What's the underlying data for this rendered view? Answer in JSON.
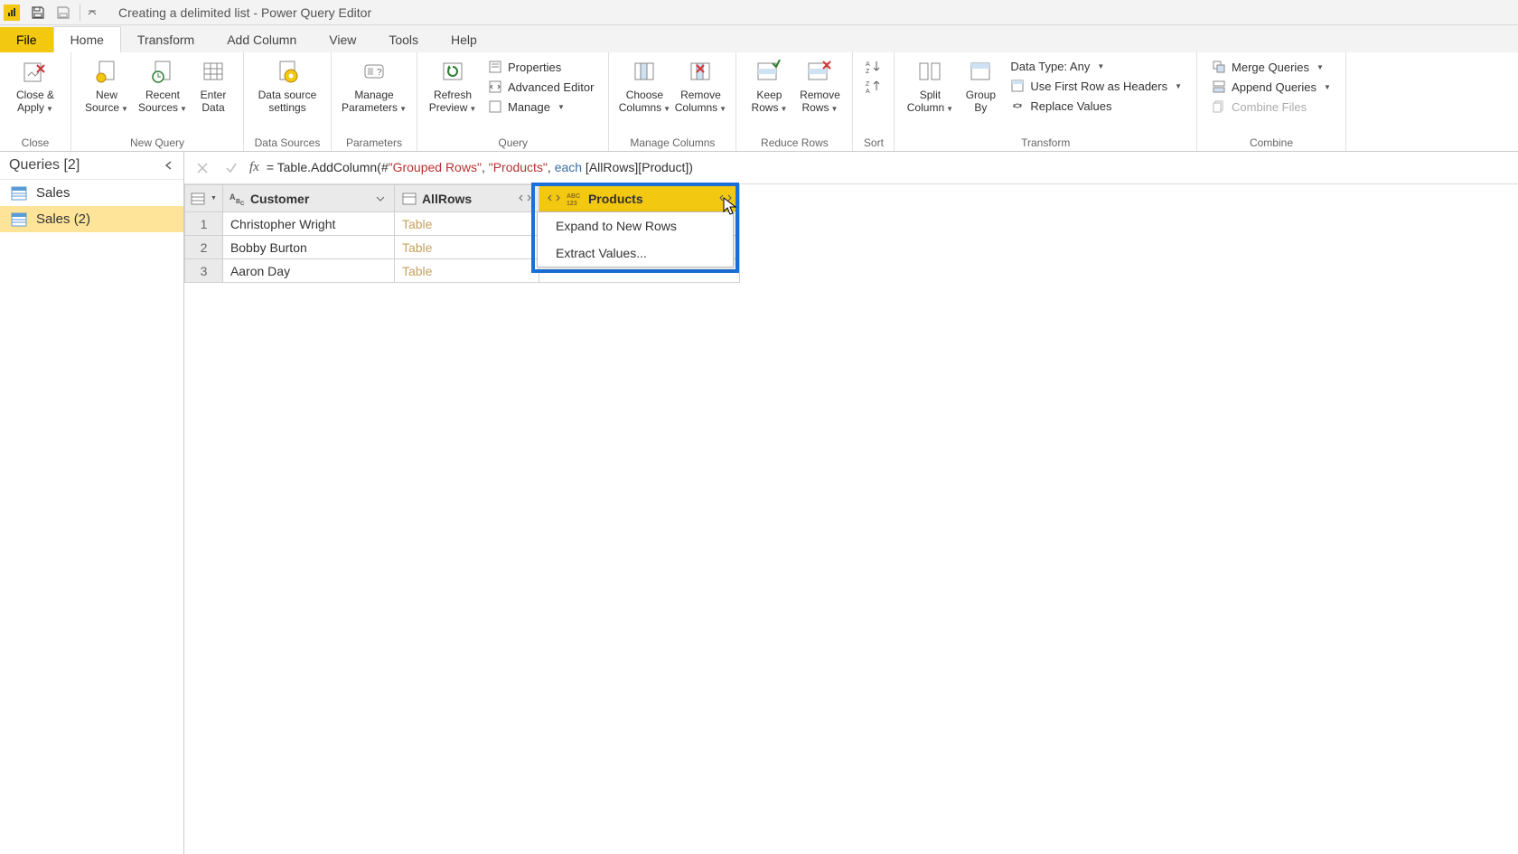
{
  "window": {
    "title": "Creating a delimited list - Power Query Editor"
  },
  "tabs": {
    "file": "File",
    "home": "Home",
    "transform": "Transform",
    "addColumn": "Add Column",
    "view": "View",
    "tools": "Tools",
    "help": "Help"
  },
  "ribbon": {
    "close": {
      "closeApply": "Close &\nApply",
      "group": "Close"
    },
    "newQuery": {
      "newSource": "New\nSource",
      "recentSources": "Recent\nSources",
      "enterData": "Enter\nData",
      "group": "New Query"
    },
    "dataSources": {
      "settings": "Data source\nsettings",
      "group": "Data Sources"
    },
    "parameters": {
      "manage": "Manage\nParameters",
      "group": "Parameters"
    },
    "query": {
      "refresh": "Refresh\nPreview",
      "properties": "Properties",
      "advEditor": "Advanced Editor",
      "manage": "Manage",
      "group": "Query"
    },
    "manageColumns": {
      "choose": "Choose\nColumns",
      "remove": "Remove\nColumns",
      "group": "Manage Columns"
    },
    "reduceRows": {
      "keep": "Keep\nRows",
      "remove": "Remove\nRows",
      "group": "Reduce Rows"
    },
    "sort": {
      "group": "Sort"
    },
    "transform": {
      "split": "Split\nColumn",
      "groupBy": "Group\nBy",
      "dataType": "Data Type: Any",
      "firstRow": "Use First Row as Headers",
      "replace": "Replace Values",
      "group": "Transform"
    },
    "combine": {
      "merge": "Merge Queries",
      "append": "Append Queries",
      "combineFiles": "Combine Files",
      "group": "Combine"
    }
  },
  "queries": {
    "header": "Queries [2]",
    "items": [
      {
        "name": "Sales",
        "selected": false
      },
      {
        "name": "Sales (2)",
        "selected": true
      }
    ]
  },
  "formula": {
    "prefix": "= Table.AddColumn(#",
    "str1": "\"Grouped Rows\"",
    "sep1": ", ",
    "str2": "\"Products\"",
    "sep2": ", ",
    "kw": "each",
    "suffix": " [AllRows][Product])"
  },
  "table": {
    "columns": {
      "customer": "Customer",
      "allrows": "AllRows",
      "products": "Products"
    },
    "rows": [
      {
        "n": "1",
        "customer": "Christopher Wright",
        "allrows": "Table"
      },
      {
        "n": "2",
        "customer": "Bobby Burton",
        "allrows": "Table"
      },
      {
        "n": "3",
        "customer": "Aaron Day",
        "allrows": "Table"
      }
    ]
  },
  "expandMenu": {
    "expandRows": "Expand to New Rows",
    "extractValues": "Extract Values..."
  }
}
